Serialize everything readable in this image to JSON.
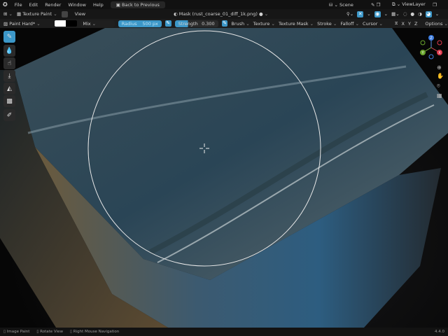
{
  "topbar": {
    "menus": [
      "File",
      "Edit",
      "Render",
      "Window",
      "Help"
    ],
    "back_button": "Back to Previous",
    "scene": "Scene",
    "view_layer": "ViewLayer"
  },
  "header": {
    "mode": "Texture Paint",
    "view": "View",
    "mask": "Mask (rust_coarse_01_diff_1k.png)"
  },
  "toolheader": {
    "brush": "Paint Hard*",
    "blend": "Mix",
    "radius_label": "Radius",
    "radius_value": "500 px",
    "strength_label": "Strength",
    "strength_value": "0.300",
    "menus": [
      "Brush",
      "Texture",
      "Texture Mask",
      "Stroke",
      "Falloff",
      "Cursor"
    ],
    "axes": [
      "X",
      "Y",
      "Z"
    ],
    "options": "Options"
  },
  "colors": {
    "primary": "#ffffff",
    "secondary": "#000000",
    "accent": "#3c97c8"
  },
  "gizmo": {
    "x": "X",
    "y": "Y",
    "z": "Z"
  },
  "status": {
    "items": [
      "Image Paint",
      "Rotate View",
      "Right Mouse Navigation"
    ],
    "version": "4.4.0"
  }
}
